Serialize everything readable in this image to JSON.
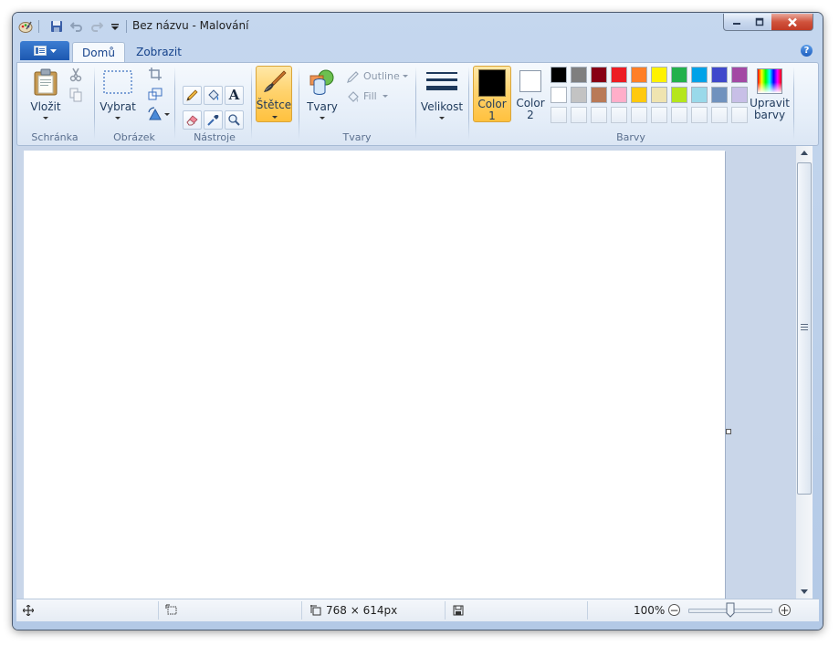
{
  "window": {
    "title": "Bez názvu - Malování"
  },
  "tabs": {
    "home": "Domů",
    "view": "Zobrazit"
  },
  "ribbon": {
    "clipboard": {
      "paste": "Vložit",
      "group": "Schránka"
    },
    "image": {
      "select": "Vybrat",
      "group": "Obrázek"
    },
    "tools": {
      "group": "Nástroje"
    },
    "brushes": {
      "label": "Štětce"
    },
    "shapes": {
      "shapes": "Tvary",
      "outline": "Outline",
      "fill": "Fill",
      "group": "Tvary"
    },
    "size": {
      "label": "Velikost"
    },
    "colors": {
      "color1_line1": "Color",
      "color1_line2": "1",
      "color2_line1": "Color",
      "color2_line2": "2",
      "edit_line1": "Upravit",
      "edit_line2": "barvy",
      "group": "Barvy",
      "color1_value": "#000000",
      "color2_value": "#ffffff",
      "palette_row1": [
        "#000000",
        "#7f7f7f",
        "#880015",
        "#ed1c24",
        "#ff7f27",
        "#fff200",
        "#22b14c",
        "#00a2e8",
        "#3f48cc",
        "#a349a4"
      ],
      "palette_row2": [
        "#ffffff",
        "#c3c3c3",
        "#b97a57",
        "#ffaec9",
        "#ffc90e",
        "#efe4b0",
        "#b5e61d",
        "#99d9ea",
        "#7092be",
        "#c8bfe7"
      ]
    }
  },
  "statusbar": {
    "image_size": "768 × 614px",
    "zoom": "100%"
  }
}
